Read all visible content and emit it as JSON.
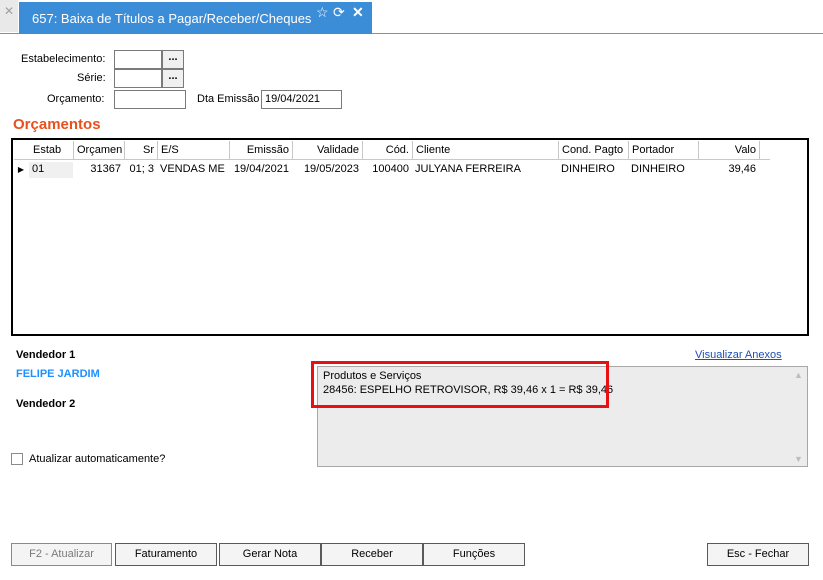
{
  "tab": {
    "left_close_icon": "close-icon",
    "title": "657: Baixa de Títulos a Pagar/Receber/Cheques",
    "icons": [
      "star-icon",
      "refresh-icon",
      "close-icon"
    ]
  },
  "form": {
    "estabelecimento_label": "Estabelecimento:",
    "estabelecimento_value": "",
    "serie_label": "Série:",
    "serie_value": "",
    "orcamento_label": "Orçamento:",
    "orcamento_value": "",
    "dta_emissao_label": "Dta Emissão",
    "dta_emissao_value": "19/04/2021",
    "lookup_label": "..."
  },
  "section_title": "Orçamentos",
  "grid": {
    "columns": [
      "Estab",
      "Orçamen",
      "Sr",
      "E/S",
      "Emissão",
      "Validade",
      "Cód.",
      "Cliente",
      "Cond. Pagto",
      "Portador",
      "Valo"
    ],
    "rows": [
      [
        "01",
        "31367",
        "01; 3",
        "VENDAS ME",
        "19/04/2021",
        "19/05/2023",
        "100400",
        "JULYANA FERREIRA",
        "DINHEIRO",
        "DINHEIRO",
        "39,46"
      ]
    ]
  },
  "vendedor1_label": "Vendedor 1",
  "vendedor1_name": "FELIPE JARDIM",
  "vendedor2_label": "Vendedor 2",
  "vendedor2_name": "",
  "anexos_link": "Visualizar Anexos",
  "memo": {
    "title": "Produtos e Serviços",
    "line": "28456: ESPELHO RETROVISOR, R$ 39,46 x 1 = R$ 39,46"
  },
  "auto_update_label": "Atualizar automaticamente?",
  "auto_update_checked": false,
  "buttons": {
    "atualizar": "F2 - Atualizar",
    "faturamento": "Faturamento",
    "gerar_nota": "Gerar Nota",
    "receber": "Receber",
    "funcoes": "Funções",
    "fechar": "Esc - Fechar"
  },
  "colors": {
    "tab_active": "#3c8dd8",
    "section_title": "#e8511e",
    "vendor_name": "#1e90ff",
    "highlight": "#e81010"
  }
}
